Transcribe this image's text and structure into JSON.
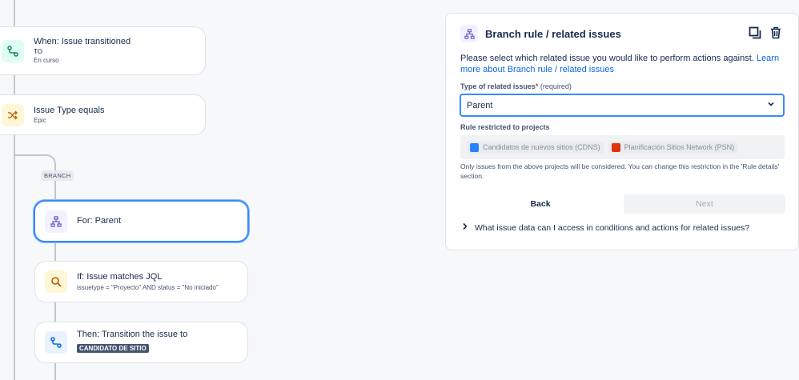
{
  "flow": {
    "trigger": {
      "title": "When: Issue transitioned",
      "to_label": "TO",
      "status": "En curso"
    },
    "condition": {
      "title": "Issue Type equals",
      "value": "Epic"
    },
    "branch_tag": "BRANCH",
    "branch_card": {
      "title": "For: Parent"
    },
    "jql_card": {
      "title": "If: Issue matches JQL",
      "query": "issuetype = \"Proyecto\" AND status = \"No iniciado\""
    },
    "action_card": {
      "title": "Then: Transition the issue to",
      "target_status": "CANDIDATO DE SITIO"
    }
  },
  "panel": {
    "title": "Branch rule / related issues",
    "description": "Please select which related issue you would like to perform actions against.",
    "learn_more_link": "Learn more about Branch rule / related issues",
    "type_label": "Type of related issues",
    "required_mark": "*",
    "required_text": "(required)",
    "type_value": "Parent",
    "restricted_label": "Rule restricted to projects",
    "projects": [
      {
        "name": "Candidatos de nuevos sitios (CDNS)",
        "color": "#2684ff"
      },
      {
        "name": "Planificación Sitios Network (PSN)",
        "color": "#de350b"
      }
    ],
    "hint": "Only issues from the above projects will be considered. You can change this restriction in the 'Rule details' section.",
    "back_label": "Back",
    "next_label": "Next",
    "faq_label": "What issue data can I access in conditions and actions for related issues?"
  },
  "icons": {
    "trigger": "transition-icon",
    "condition": "shuffle-icon",
    "branch": "hierarchy-icon",
    "jql": "search-icon",
    "action": "transition-icon",
    "duplicate": "copy-icon",
    "delete": "trash-icon"
  },
  "colors": {
    "accent": "#388bff",
    "link": "#0c66e4",
    "required": "#c9372c"
  }
}
